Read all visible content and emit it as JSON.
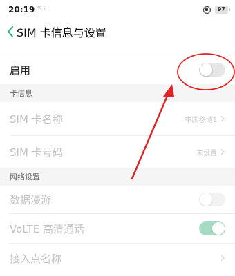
{
  "status_bar": {
    "time": "20:19",
    "signal": "⁴ᴳ.ıl",
    "battery": "97"
  },
  "header": {
    "title": "SIM 卡信息与设置"
  },
  "rows": {
    "enable": {
      "label": "启用",
      "toggle": "off"
    },
    "sim_name": {
      "label": "SIM 卡名称",
      "value": "中国移动1"
    },
    "sim_number": {
      "label": "SIM 卡号码",
      "value": "未设置"
    },
    "roaming": {
      "label": "数据漫游",
      "toggle": "off"
    },
    "volte": {
      "label": "VoLTE 高清通话",
      "toggle": "on"
    },
    "apn": {
      "label": "接入点名称"
    }
  },
  "sections": {
    "card_info": "卡信息",
    "network": "网络设置"
  },
  "colors": {
    "annotation_red": "#e02424",
    "toggle_on": "#a7dcc4",
    "back_arrow": "#2bb673"
  }
}
